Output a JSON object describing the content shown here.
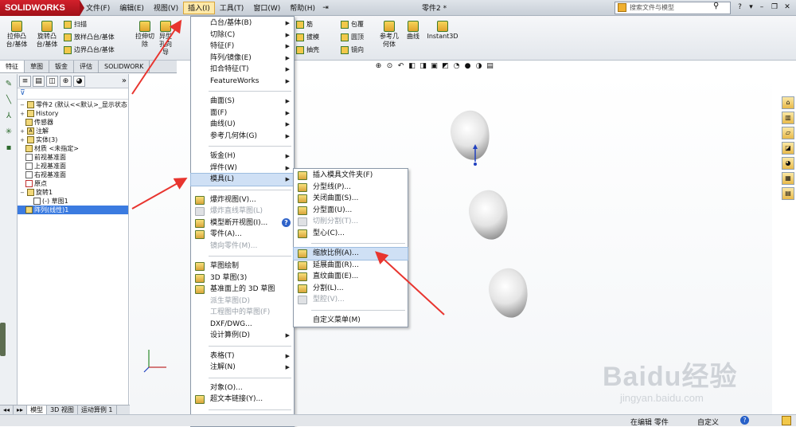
{
  "app": {
    "logo_text": "SOLIDWORKS",
    "document_title": "零件2 *"
  },
  "menubar": {
    "items": [
      "文件(F)",
      "编辑(E)",
      "视图(V)",
      "插入(I)",
      "工具(T)",
      "窗口(W)",
      "帮助(H)"
    ],
    "active_index": 3
  },
  "search": {
    "placeholder": "搜索文件与模型"
  },
  "ribbon": {
    "big_buttons": [
      "拉伸凸台/基体",
      "旋转凸台/基体",
      "拉伸切除",
      "异型孔向导",
      "参考几何体",
      "曲线",
      "Instant3D"
    ],
    "small_buttons": [
      "扫描",
      "放样凸台/基体",
      "边界凸台/基体",
      "筋",
      "拔模",
      "抽壳",
      "包覆",
      "圆顶",
      "镜向"
    ]
  },
  "tabs": {
    "items": [
      "特征",
      "草图",
      "钣金",
      "评估",
      "SOLIDWORK"
    ],
    "active_index": 0
  },
  "feature_tree": {
    "root": "零件2 (默认<<默认>_显示状态",
    "nodes": [
      "History",
      "传感器",
      "注解",
      "实体(3)",
      "材质 <未指定>",
      "前视基准面",
      "上视基准面",
      "右视基准面",
      "原点",
      "旋转1",
      "(-) 草图1",
      "阵列(线性)1"
    ],
    "selected": "阵列(线性)1"
  },
  "bottom_tabs": {
    "items": [
      "模型",
      "3D 视图",
      "运动算例 1"
    ],
    "active_index": 0
  },
  "insert_menu": {
    "items": [
      {
        "label": "凸台/基体(B)",
        "sub": true
      },
      {
        "label": "切除(C)",
        "sub": true
      },
      {
        "label": "特征(F)",
        "sub": true
      },
      {
        "label": "阵列/镜像(E)",
        "sub": true
      },
      {
        "label": "扣合特征(T)",
        "sub": true
      },
      {
        "label": "FeatureWorks",
        "sub": true
      },
      {
        "sep": true
      },
      {
        "label": "曲面(S)",
        "sub": true
      },
      {
        "label": "面(F)",
        "sub": true
      },
      {
        "label": "曲线(U)",
        "sub": true
      },
      {
        "label": "参考几何体(G)",
        "sub": true
      },
      {
        "sep": true
      },
      {
        "label": "钣金(H)",
        "sub": true
      },
      {
        "label": "焊件(W)",
        "sub": true
      },
      {
        "label": "模具(L)",
        "sub": true,
        "highlight": true
      },
      {
        "sep": true
      },
      {
        "label": "爆炸视图(V)...",
        "icon": true
      },
      {
        "label": "爆炸直线草图(L)",
        "icon": true,
        "disabled": true
      },
      {
        "label": "模型断开视图(I)...",
        "icon": true,
        "help": true
      },
      {
        "label": "零件(A)...",
        "icon": true
      },
      {
        "label": "镜向零件(M)...",
        "disabled": true
      },
      {
        "sep": true
      },
      {
        "label": "草图绘制",
        "icon": true
      },
      {
        "label": "3D 草图(3)",
        "icon": true
      },
      {
        "label": "基准面上的 3D 草图",
        "icon": true
      },
      {
        "label": "派生草图(D)",
        "disabled": true
      },
      {
        "label": "工程图中的草图(F)",
        "disabled": true
      },
      {
        "label": "DXF/DWG..."
      },
      {
        "label": "设计算例(D)",
        "sub": true
      },
      {
        "sep": true
      },
      {
        "label": "表格(T)",
        "sub": true
      },
      {
        "label": "注解(N)",
        "sub": true
      },
      {
        "sep": true
      },
      {
        "label": "对象(O)..."
      },
      {
        "label": "超文本链接(Y)...",
        "icon": true
      },
      {
        "sep": true
      },
      {
        "label": "自定义菜单(M)"
      }
    ]
  },
  "mold_submenu": {
    "items": [
      {
        "label": "插入模具文件夹(F)",
        "icon": true
      },
      {
        "label": "分型线(P)...",
        "icon": true
      },
      {
        "label": "关闭曲面(S)...",
        "icon": true
      },
      {
        "label": "分型面(U)...",
        "icon": true
      },
      {
        "label": "切削分割(T)...",
        "icon": true,
        "disabled": true
      },
      {
        "label": "型心(C)...",
        "icon": true
      },
      {
        "sep": true
      },
      {
        "label": "缩放比例(A)...",
        "icon": true,
        "highlight": true
      },
      {
        "label": "延展曲面(R)...",
        "icon": true
      },
      {
        "label": "直纹曲面(E)...",
        "icon": true
      },
      {
        "label": "分割(L)...",
        "icon": true
      },
      {
        "label": "型腔(V)...",
        "icon": true,
        "disabled": true
      },
      {
        "sep": true
      },
      {
        "label": "自定义菜单(M)"
      }
    ]
  },
  "status": {
    "editing": "在编辑 零件",
    "custom": "自定义"
  },
  "watermark": {
    "big": "Baidu经验",
    "small": "jingyan.baidu.com"
  },
  "colors": {
    "logo_red": "#c41a24",
    "arrow_red": "#e8352f",
    "highlight_blue": "#cfe0f5",
    "selected_blue": "#3b7be0"
  }
}
